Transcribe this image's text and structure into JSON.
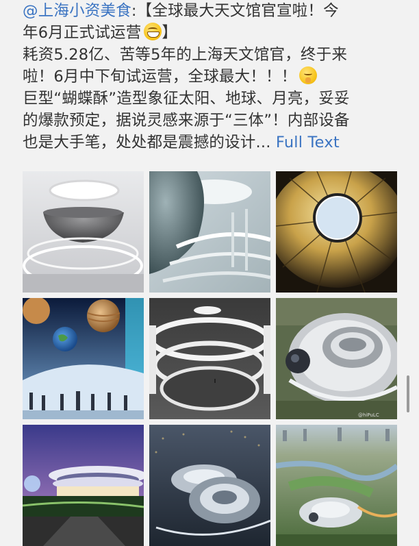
{
  "post": {
    "mention": "@上海小资美食",
    "line1_rest": ":【全球最大天文馆官宣啦！今",
    "line2": "年6月正式试运营",
    "line2_end": "】",
    "line3": "耗资5.28亿、苦等5年的上海天文馆官，终于来",
    "line4": "啦！6月中下旬试运营，全球最大！！！",
    "line5": "巨型“蝴蝶酥”造型象征太阳、地球、月亮，妥妥",
    "line6": "的爆款预定，据说灵感来源于“三体”！内部设备",
    "line7": "也是大手笔，处处都是震撼的设计...",
    "full_text_link": "Full Text"
  },
  "emoji": {
    "grin": "grinning-face-emoji",
    "shush": "shushing-face-emoji"
  },
  "images": [
    {
      "name": "photo-interior-dome"
    },
    {
      "name": "photo-sphere-walkway"
    },
    {
      "name": "photo-oculus-golden"
    },
    {
      "name": "photo-planets-exhibit"
    },
    {
      "name": "photo-spiral-ramp"
    },
    {
      "name": "photo-aerial-building"
    },
    {
      "name": "photo-night-exterior"
    },
    {
      "name": "photo-aerial-night"
    },
    {
      "name": "photo-aerial-landscape"
    }
  ],
  "watermark": "@hiPuLC",
  "colors": {
    "link": "#3b74c2",
    "text": "#333333",
    "background": "#f2f2f2"
  }
}
